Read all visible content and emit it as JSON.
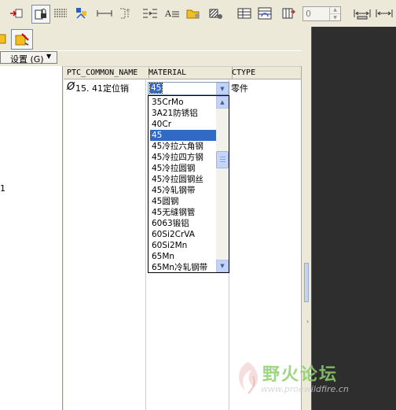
{
  "toolbar": {
    "spinner_value": "0",
    "settings_label": "设置 (G)"
  },
  "table": {
    "columns": [
      "PTC_COMMON_NAME",
      "MATERIAL",
      "CTYPE"
    ],
    "row": {
      "diameter_symbol": "Ø",
      "name": "15. 41定位销",
      "material": "45",
      "ctype": "零件"
    }
  },
  "left_panel": {
    "fragment": "1"
  },
  "material_list": {
    "items": [
      "35CrMo",
      "3A21防锈铝",
      "40Cr",
      "45",
      "45冷拉六角钢",
      "45冷拉四方钢",
      "45冷拉圆钢",
      "45冷拉圆钢丝",
      "45冷轧钢带",
      "45圆钢",
      "45无缝钢管",
      "6063锻铝",
      "60Si2CrVA",
      "60Si2Mn",
      "65Mn",
      "65Mn冷轧钢带"
    ],
    "selected_index": 3
  },
  "watermark": {
    "title": "野火论坛",
    "url": "www.proewildfire.cn"
  },
  "colors": {
    "selection": "#316ac5",
    "watermark_green": "#6ab04c",
    "dark_panel": "#2e2e2e"
  }
}
